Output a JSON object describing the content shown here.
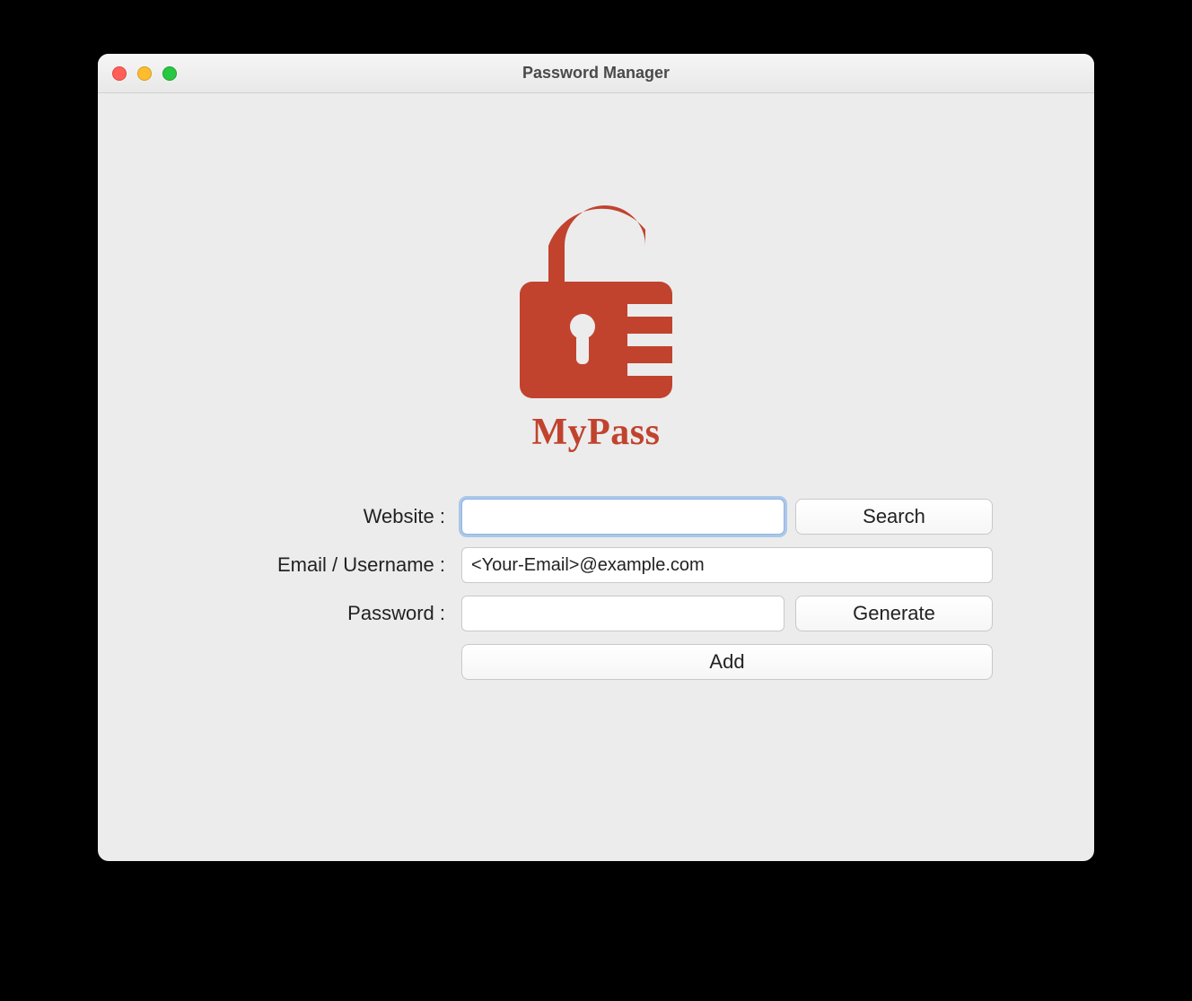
{
  "window": {
    "title": "Password Manager"
  },
  "logo": {
    "name": "MyPass"
  },
  "form": {
    "website_label": "Website :",
    "website_value": "",
    "email_label": "Email / Username :",
    "email_value": "<Your-Email>@example.com",
    "password_label": "Password :",
    "password_value": "",
    "search_button": "Search",
    "generate_button": "Generate",
    "add_button": "Add"
  },
  "colors": {
    "accent": "#c1432e"
  }
}
